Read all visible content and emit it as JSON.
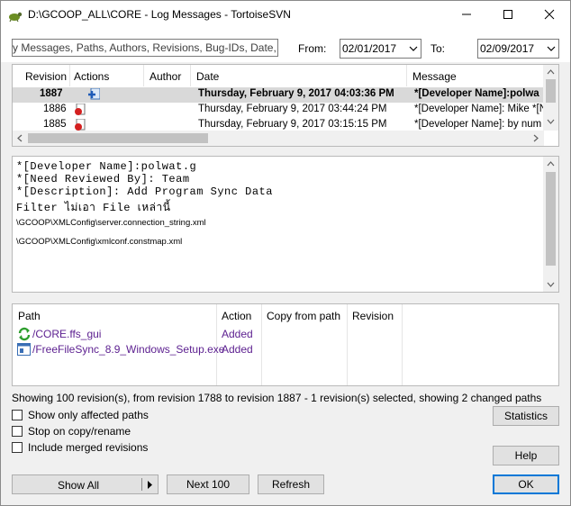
{
  "window": {
    "title": "D:\\GCOOP_ALL\\CORE - Log Messages - TortoiseSVN"
  },
  "filter": {
    "search_text": "y Messages, Paths, Authors, Revisions, Bug-IDs, Date, Date",
    "from_label": "From:",
    "from_date": "02/01/2017",
    "to_label": "To:",
    "to_date": "02/09/2017"
  },
  "revisions": {
    "columns": [
      "Revision",
      "Actions",
      "Author",
      "Date",
      "Message"
    ],
    "rows": [
      {
        "revision": "1887",
        "date": "Thursday, February 9, 2017 04:03:36 PM",
        "message": "*[Developer Name]:polwa",
        "selected": true
      },
      {
        "revision": "1886",
        "date": "Thursday, February 9, 2017 03:44:24 PM",
        "message": "*[Developer Name]: Mike *[Ne",
        "selected": false
      },
      {
        "revision": "1885",
        "date": "Thursday, February 9, 2017 03:15:15 PM",
        "message": "*[Developer Name]: by num *",
        "selected": false
      }
    ]
  },
  "message": {
    "lines": [
      "*[Developer Name]:polwat.g",
      "*[Need Reviewed By]: Team",
      "*[Description]: Add Program Sync Data",
      "Filter ไม่เอา File เหล่านี้"
    ],
    "paths": [
      "\\GCOOP\\XMLConfig\\server.connection_string.xml",
      "\\GCOOP\\XMLConfig\\xmlconf.constmap.xml"
    ]
  },
  "changed_paths": {
    "columns": [
      "Path",
      "Action",
      "Copy from path",
      "Revision"
    ],
    "rows": [
      {
        "path": "/CORE.ffs_gui",
        "action": "Added"
      },
      {
        "path": "/FreeFileSync_8.9_Windows_Setup.exe",
        "action": "Added"
      }
    ]
  },
  "status": "Showing 100 revision(s), from revision 1788 to revision 1887 - 1 revision(s) selected, showing 2 changed paths",
  "options": {
    "only_affected": "Show only affected paths",
    "stop_on_copy": "Stop on copy/rename",
    "include_merged": "Include merged revisions"
  },
  "buttons": {
    "statistics": "Statistics",
    "help": "Help",
    "show_all": "Show All",
    "next_100": "Next 100",
    "refresh": "Refresh",
    "ok": "OK"
  },
  "colors": {
    "selection": "#d9d9d9",
    "added_text": "#5b1e8f",
    "accent": "#0078d7"
  }
}
